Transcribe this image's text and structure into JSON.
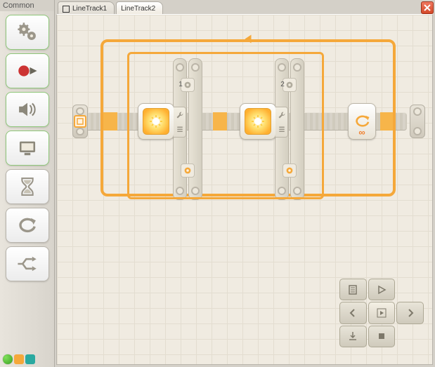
{
  "sidebar": {
    "label": "Common",
    "items": [
      {
        "name": "move-block",
        "icon": "gears"
      },
      {
        "name": "record-play-block",
        "icon": "record-play"
      },
      {
        "name": "sound-block",
        "icon": "speaker"
      },
      {
        "name": "display-block",
        "icon": "display"
      },
      {
        "name": "wait-block",
        "icon": "hourglass"
      },
      {
        "name": "loop-block",
        "icon": "loop"
      },
      {
        "name": "switch-block",
        "icon": "switch"
      }
    ]
  },
  "tabs": [
    {
      "label": "LineTrack1",
      "active": false
    },
    {
      "label": "LineTrack2",
      "active": true
    }
  ],
  "program": {
    "loop": {
      "mode": "forever",
      "mode_icon": "infinity"
    },
    "switches": [
      {
        "index": 1,
        "sensor": "light",
        "port_label": "1"
      },
      {
        "index": 2,
        "sensor": "light",
        "port_label": "2"
      }
    ]
  },
  "nav": {
    "buttons": [
      "doc",
      "play-outline",
      "left",
      "play",
      "right",
      "download",
      "stop",
      "blank",
      "blank2"
    ]
  },
  "status": {
    "dots": [
      "green",
      "orange-sq",
      "teal-sq"
    ]
  }
}
